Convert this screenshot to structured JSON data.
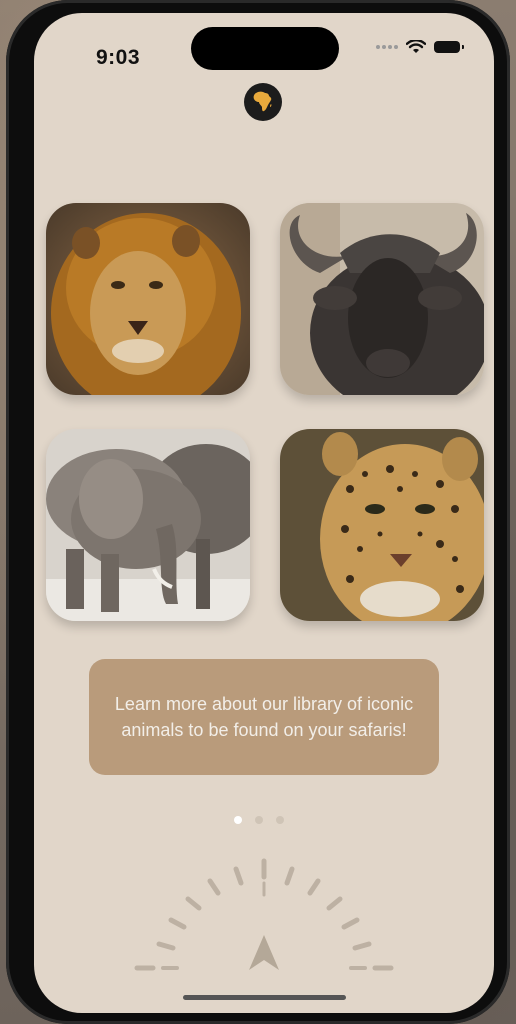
{
  "status_bar": {
    "time": "9:03"
  },
  "app": {
    "logo_icon": "africa-map-icon",
    "animals": [
      {
        "name": "lion",
        "image": "lion-photo"
      },
      {
        "name": "buffalo",
        "image": "buffalo-photo"
      },
      {
        "name": "elephant",
        "image": "elephant-photo"
      },
      {
        "name": "leopard",
        "image": "leopard-photo"
      }
    ],
    "info_text": "Learn more about our library of iconic animals to be found on your safaris!",
    "page_indicator": {
      "count": 3,
      "current": 1
    },
    "compass_icon": "compass-dial-icon"
  },
  "colors": {
    "background": "#e1d6c9",
    "card": "#b99b7b",
    "logo": "#e8a93c"
  }
}
